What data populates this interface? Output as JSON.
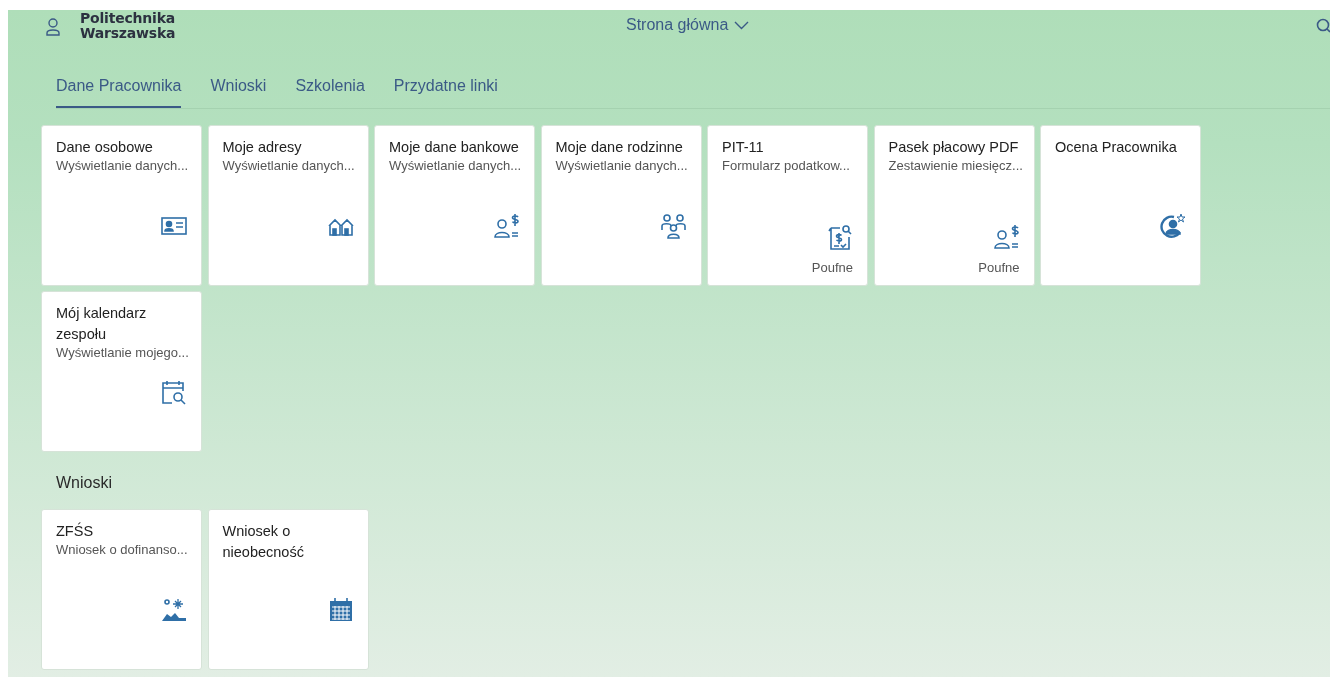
{
  "header": {
    "logo_lines": [
      "Politechnika",
      "Warszawska"
    ],
    "title": "Strona główna"
  },
  "tabs": [
    {
      "label": "Dane Pracownika",
      "selected": true
    },
    {
      "label": "Wnioski",
      "selected": false
    },
    {
      "label": "Szkolenia",
      "selected": false
    },
    {
      "label": "Przydatne linki",
      "selected": false
    }
  ],
  "sections": [
    {
      "tiles": [
        {
          "title": "Dane osobowe",
          "subtitle": "Wyświetlanie danych...",
          "kind": "id-card"
        },
        {
          "title": "Moje adresy",
          "subtitle": "Wyświetlanie danych...",
          "kind": "houses"
        },
        {
          "title": "Moje dane bankowe",
          "subtitle": "Wyświetlanie danych...",
          "kind": "person-dollar"
        },
        {
          "title": "Moje dane rodzinne",
          "subtitle": "Wyświetlanie danych...",
          "kind": "family"
        },
        {
          "title": "PIT-11",
          "subtitle": "Formularz podatkow...",
          "kind": "tax-document",
          "footer": "Poufne"
        },
        {
          "title": "Pasek płacowy PDF",
          "subtitle": "Zestawienie miesięcz...",
          "kind": "person-dollar",
          "footer": "Poufne"
        },
        {
          "title": "Ocena Pracownika",
          "kind": "person-star"
        },
        {
          "title": "Mój kalendarz zespołu",
          "subtitle": "Wyświetlanie mojego...",
          "kind": "calendar-search"
        }
      ]
    },
    {
      "heading": "Wnioski",
      "tiles": [
        {
          "title": "ZFŚS",
          "subtitle": "Wniosek o dofinanso...",
          "kind": "island"
        },
        {
          "title": "Wniosek o nieobecność",
          "kind": "calendar"
        }
      ]
    }
  ]
}
